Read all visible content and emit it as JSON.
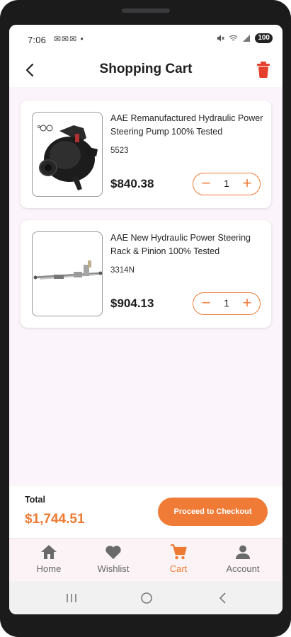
{
  "status_bar": {
    "time": "7:06",
    "notification_icons": "✉✉✉ •",
    "battery": "100"
  },
  "header": {
    "title": "Shopping Cart"
  },
  "cart": {
    "items": [
      {
        "name": "AAE Remanufactured Hydraulic Power Steering Pump 100% Tested",
        "sku": "5523",
        "price": "$840.38",
        "quantity": "1",
        "image_icon": "power-steering-pump-image"
      },
      {
        "name": "AAE New Hydraulic Power Steering Rack & Pinion 100% Tested",
        "sku": "3314N",
        "price": "$904.13",
        "quantity": "1",
        "image_icon": "steering-rack-image"
      }
    ],
    "stepper": {
      "minus": "−",
      "plus": "+"
    }
  },
  "checkout": {
    "total_label": "Total",
    "total_value": "$1,744.51",
    "button_label": "Proceed to Checkout"
  },
  "bottom_nav": {
    "items": [
      {
        "label": "Home",
        "icon": "home-icon",
        "active": false
      },
      {
        "label": "Wishlist",
        "icon": "heart-icon",
        "active": false
      },
      {
        "label": "Cart",
        "icon": "cart-icon",
        "active": true
      },
      {
        "label": "Account",
        "icon": "account-icon",
        "active": false
      }
    ]
  },
  "colors": {
    "accent": "#ef7b36",
    "delete": "#e5402b",
    "background": "#fbf5fb"
  }
}
